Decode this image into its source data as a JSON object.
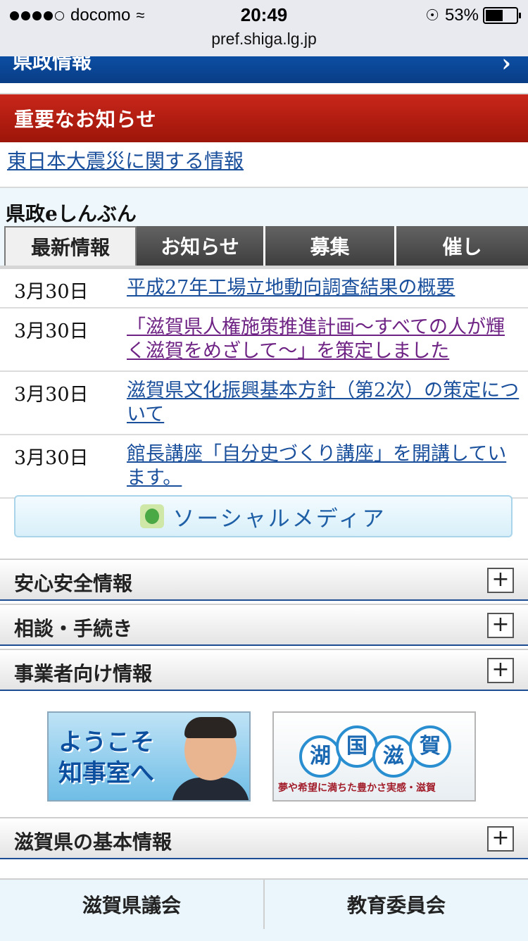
{
  "status_bar": {
    "carrier": "docomo",
    "time": "20:49",
    "battery": "53%",
    "battery_level": 0.53,
    "url": "pref.shiga.lg.jp"
  },
  "nav_strip": {
    "label": "県政情報"
  },
  "important": {
    "title": "重要なお知らせ",
    "link": "東日本大震災に関する情報"
  },
  "news": {
    "title": "県政eしんぶん",
    "tabs": [
      "最新情報",
      "お知らせ",
      "募集",
      "催し"
    ],
    "active_tab": 0,
    "items": [
      {
        "date": "3月30日",
        "title": "平成27年工場立地動向調査結果の概要",
        "visited": false
      },
      {
        "date": "3月30日",
        "title": "「滋賀県人権施策推進計画～すべての人が輝く滋賀をめざして～」を策定しました",
        "visited": true
      },
      {
        "date": "3月30日",
        "title": "滋賀県文化振興基本方針（第2次）の策定について",
        "visited": false
      },
      {
        "date": "3月30日",
        "title": "館長講座「自分史づくり講座」を開講しています。",
        "visited": false
      }
    ]
  },
  "social": {
    "label": "ソーシャルメディア",
    "icon": "character-icon"
  },
  "accordion": [
    {
      "label": "安心安全情報",
      "icon": "plus-icon"
    },
    {
      "label": "相談・手続き",
      "icon": "plus-icon"
    },
    {
      "label": "事業者向け情報",
      "icon": "plus-icon"
    },
    {
      "label": "滋賀県の基本情報",
      "icon": "plus-icon"
    }
  ],
  "banners": {
    "governor": {
      "line1": "ようこそ",
      "line2": "知事室へ"
    },
    "lake": {
      "chars": [
        "湖",
        "国",
        "滋",
        "賀"
      ],
      "tagline": "夢や希望に満ちた豊かさ実感・滋賀"
    }
  },
  "grid": [
    "滋賀県議会",
    "教育委員会"
  ],
  "colors": {
    "accent_blue": "#0c4ea3",
    "notice_red": "#c9261a",
    "link": "#1a4f9c",
    "visited": "#6e2384"
  }
}
